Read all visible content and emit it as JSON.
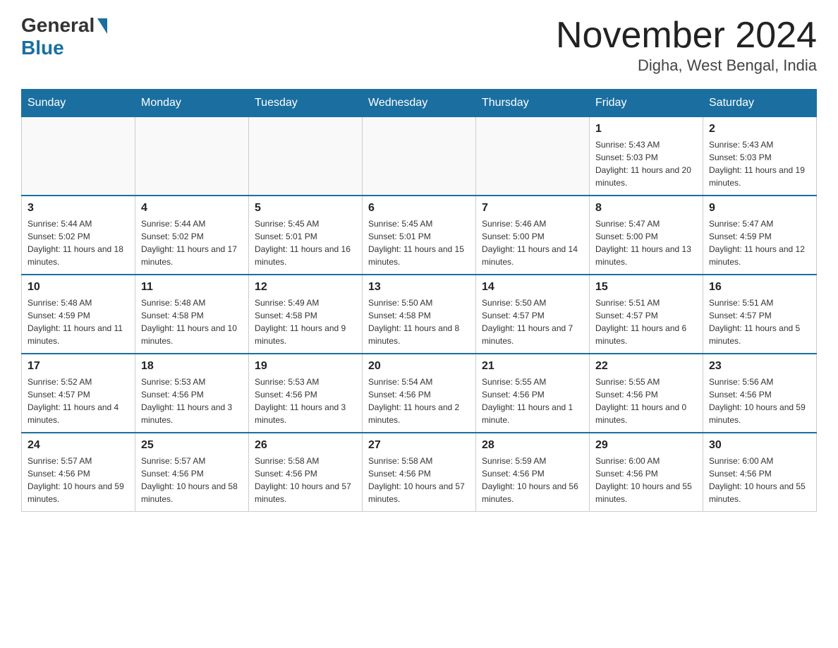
{
  "header": {
    "logo_general": "General",
    "logo_blue": "Blue",
    "month_title": "November 2024",
    "location": "Digha, West Bengal, India"
  },
  "days_of_week": [
    "Sunday",
    "Monday",
    "Tuesday",
    "Wednesday",
    "Thursday",
    "Friday",
    "Saturday"
  ],
  "weeks": [
    [
      {
        "day": "",
        "info": ""
      },
      {
        "day": "",
        "info": ""
      },
      {
        "day": "",
        "info": ""
      },
      {
        "day": "",
        "info": ""
      },
      {
        "day": "",
        "info": ""
      },
      {
        "day": "1",
        "info": "Sunrise: 5:43 AM\nSunset: 5:03 PM\nDaylight: 11 hours and 20 minutes."
      },
      {
        "day": "2",
        "info": "Sunrise: 5:43 AM\nSunset: 5:03 PM\nDaylight: 11 hours and 19 minutes."
      }
    ],
    [
      {
        "day": "3",
        "info": "Sunrise: 5:44 AM\nSunset: 5:02 PM\nDaylight: 11 hours and 18 minutes."
      },
      {
        "day": "4",
        "info": "Sunrise: 5:44 AM\nSunset: 5:02 PM\nDaylight: 11 hours and 17 minutes."
      },
      {
        "day": "5",
        "info": "Sunrise: 5:45 AM\nSunset: 5:01 PM\nDaylight: 11 hours and 16 minutes."
      },
      {
        "day": "6",
        "info": "Sunrise: 5:45 AM\nSunset: 5:01 PM\nDaylight: 11 hours and 15 minutes."
      },
      {
        "day": "7",
        "info": "Sunrise: 5:46 AM\nSunset: 5:00 PM\nDaylight: 11 hours and 14 minutes."
      },
      {
        "day": "8",
        "info": "Sunrise: 5:47 AM\nSunset: 5:00 PM\nDaylight: 11 hours and 13 minutes."
      },
      {
        "day": "9",
        "info": "Sunrise: 5:47 AM\nSunset: 4:59 PM\nDaylight: 11 hours and 12 minutes."
      }
    ],
    [
      {
        "day": "10",
        "info": "Sunrise: 5:48 AM\nSunset: 4:59 PM\nDaylight: 11 hours and 11 minutes."
      },
      {
        "day": "11",
        "info": "Sunrise: 5:48 AM\nSunset: 4:58 PM\nDaylight: 11 hours and 10 minutes."
      },
      {
        "day": "12",
        "info": "Sunrise: 5:49 AM\nSunset: 4:58 PM\nDaylight: 11 hours and 9 minutes."
      },
      {
        "day": "13",
        "info": "Sunrise: 5:50 AM\nSunset: 4:58 PM\nDaylight: 11 hours and 8 minutes."
      },
      {
        "day": "14",
        "info": "Sunrise: 5:50 AM\nSunset: 4:57 PM\nDaylight: 11 hours and 7 minutes."
      },
      {
        "day": "15",
        "info": "Sunrise: 5:51 AM\nSunset: 4:57 PM\nDaylight: 11 hours and 6 minutes."
      },
      {
        "day": "16",
        "info": "Sunrise: 5:51 AM\nSunset: 4:57 PM\nDaylight: 11 hours and 5 minutes."
      }
    ],
    [
      {
        "day": "17",
        "info": "Sunrise: 5:52 AM\nSunset: 4:57 PM\nDaylight: 11 hours and 4 minutes."
      },
      {
        "day": "18",
        "info": "Sunrise: 5:53 AM\nSunset: 4:56 PM\nDaylight: 11 hours and 3 minutes."
      },
      {
        "day": "19",
        "info": "Sunrise: 5:53 AM\nSunset: 4:56 PM\nDaylight: 11 hours and 3 minutes."
      },
      {
        "day": "20",
        "info": "Sunrise: 5:54 AM\nSunset: 4:56 PM\nDaylight: 11 hours and 2 minutes."
      },
      {
        "day": "21",
        "info": "Sunrise: 5:55 AM\nSunset: 4:56 PM\nDaylight: 11 hours and 1 minute."
      },
      {
        "day": "22",
        "info": "Sunrise: 5:55 AM\nSunset: 4:56 PM\nDaylight: 11 hours and 0 minutes."
      },
      {
        "day": "23",
        "info": "Sunrise: 5:56 AM\nSunset: 4:56 PM\nDaylight: 10 hours and 59 minutes."
      }
    ],
    [
      {
        "day": "24",
        "info": "Sunrise: 5:57 AM\nSunset: 4:56 PM\nDaylight: 10 hours and 59 minutes."
      },
      {
        "day": "25",
        "info": "Sunrise: 5:57 AM\nSunset: 4:56 PM\nDaylight: 10 hours and 58 minutes."
      },
      {
        "day": "26",
        "info": "Sunrise: 5:58 AM\nSunset: 4:56 PM\nDaylight: 10 hours and 57 minutes."
      },
      {
        "day": "27",
        "info": "Sunrise: 5:58 AM\nSunset: 4:56 PM\nDaylight: 10 hours and 57 minutes."
      },
      {
        "day": "28",
        "info": "Sunrise: 5:59 AM\nSunset: 4:56 PM\nDaylight: 10 hours and 56 minutes."
      },
      {
        "day": "29",
        "info": "Sunrise: 6:00 AM\nSunset: 4:56 PM\nDaylight: 10 hours and 55 minutes."
      },
      {
        "day": "30",
        "info": "Sunrise: 6:00 AM\nSunset: 4:56 PM\nDaylight: 10 hours and 55 minutes."
      }
    ]
  ]
}
